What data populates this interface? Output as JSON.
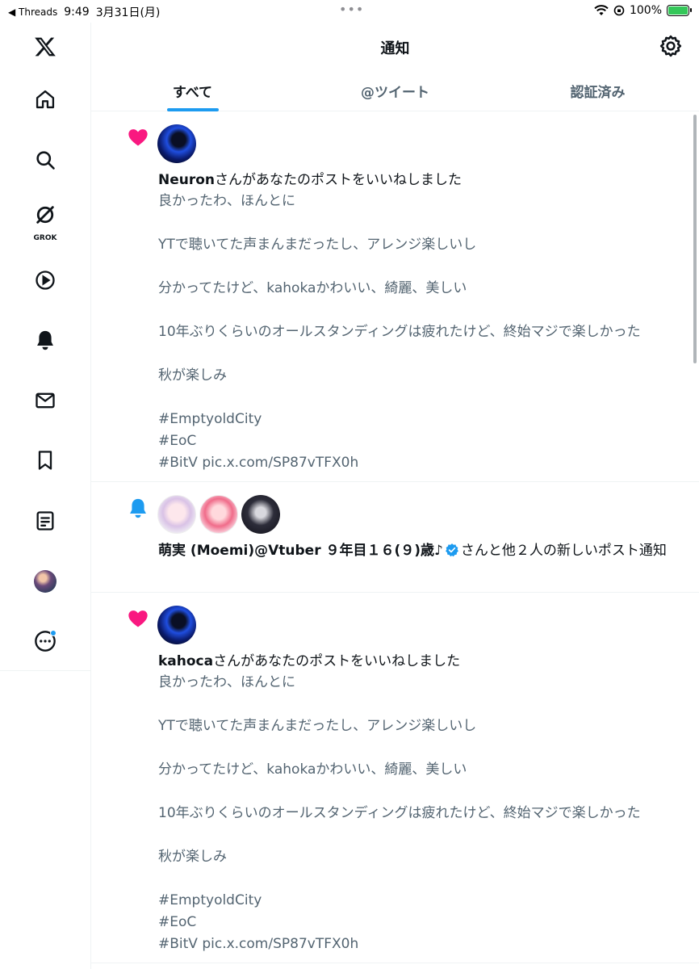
{
  "status_bar": {
    "back_app": "◀ Threads",
    "time": "9:49",
    "date": "3月31日(月)",
    "dots": "•••",
    "battery_pct": "100%"
  },
  "sidebar": {
    "items": [
      {
        "name": "x-logo-icon"
      },
      {
        "name": "home-icon"
      },
      {
        "name": "search-icon"
      },
      {
        "name": "grok-icon",
        "label": "GROK"
      },
      {
        "name": "video-icon"
      },
      {
        "name": "bell-icon"
      },
      {
        "name": "mail-icon"
      },
      {
        "name": "bookmark-icon"
      },
      {
        "name": "lists-icon"
      },
      {
        "name": "profile-avatar"
      },
      {
        "name": "more-icon"
      }
    ]
  },
  "header": {
    "title": "通知",
    "tabs": [
      {
        "label": "すべて",
        "active": true
      },
      {
        "label": "@ツイート",
        "active": false
      },
      {
        "label": "認証済み",
        "active": false
      }
    ]
  },
  "notifications": [
    {
      "type": "like",
      "user": "Neuron",
      "action": "さんがあなたのポストをいいねしました",
      "text": "良かったわ、ほんとに\n\nYTで聴いてた声まんまだったし、アレンジ楽しいし\n\n分かってたけど、kahokaかわいい、綺麗、美しい\n\n10年ぶりくらいのオールスタンディングは疲れたけど、終始マジで楽しかった\n\n秋が楽しみ\n\n#EmptyoldCity\n#EoC\n#BitV pic.x.com/SP87vTFX0h"
    },
    {
      "type": "new_post",
      "user": "萌実 (Moemi)@Vtuber ９年目１６(９)歳♪",
      "action": "さんと他２人の新しいポスト通知"
    },
    {
      "type": "like",
      "user": "kahoca",
      "action": "さんがあなたのポストをいいねしました",
      "text": "良かったわ、ほんとに\n\nYTで聴いてた声まんまだったし、アレンジ楽しいし\n\n分かってたけど、kahokaかわいい、綺麗、美しい\n\n10年ぶりくらいのオールスタンディングは疲れたけど、終始マジで楽しかった\n\n秋が楽しみ\n\n#EmptyoldCity\n#EoC\n#BitV pic.x.com/SP87vTFX0h"
    }
  ],
  "colors": {
    "accent": "#1d9bf0",
    "like": "#f91880",
    "secondary_text": "#536471",
    "battery": "#34c759"
  }
}
